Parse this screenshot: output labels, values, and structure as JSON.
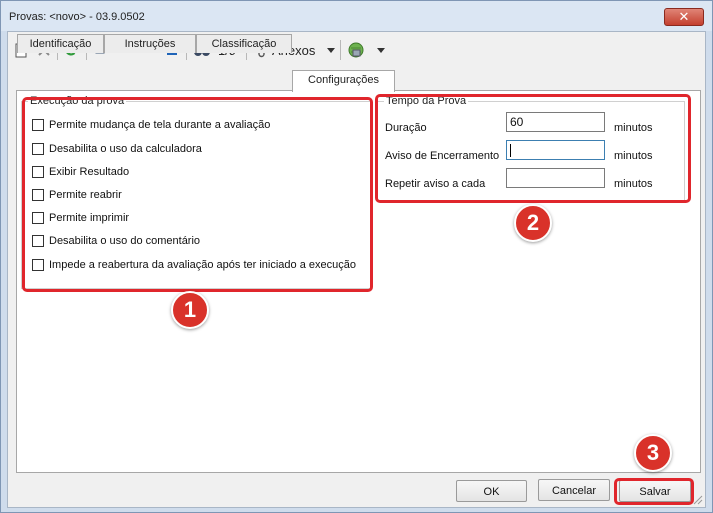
{
  "window": {
    "title": "Provas: <novo> - 03.9.0502",
    "close_label": "✕"
  },
  "toolbar": {
    "record_position": "1/9",
    "attachments_label": "Anexos"
  },
  "tabs": [
    {
      "label": "Identificação",
      "active": false
    },
    {
      "label": "Instruções",
      "active": false
    },
    {
      "label": "Classificação",
      "active": false
    },
    {
      "label": "Configurações",
      "active": true
    }
  ],
  "execution_group": {
    "title": "Execução da prova",
    "options": [
      {
        "label": "Permite mudança de tela durante a avaliação",
        "checked": false
      },
      {
        "label": "Desabilita o uso da calculadora",
        "checked": false
      },
      {
        "label": "Exibir Resultado",
        "checked": false
      },
      {
        "label": "Permite reabrir",
        "checked": false
      },
      {
        "label": "Permite imprimir",
        "checked": false
      },
      {
        "label": "Desabilita o uso do comentário",
        "checked": false
      },
      {
        "label": "Impede a reabertura da avaliação após ter iniciado a execução",
        "checked": false
      }
    ]
  },
  "time_group": {
    "title": "Tempo da Prova",
    "fields": [
      {
        "label": "Duração",
        "value": "60",
        "unit": "minutos"
      },
      {
        "label": "Aviso de Encerramento",
        "value": "",
        "unit": "minutos"
      },
      {
        "label": "Repetir aviso a cada",
        "value": "",
        "unit": "minutos"
      }
    ]
  },
  "annotations": [
    "1",
    "2",
    "3"
  ],
  "buttons": {
    "ok": "OK",
    "cancel": "Cancelar",
    "save": "Salvar"
  },
  "colors": {
    "highlight": "#e0262c",
    "badge": "#d9322a",
    "titlebar": "#dbe6f3"
  }
}
